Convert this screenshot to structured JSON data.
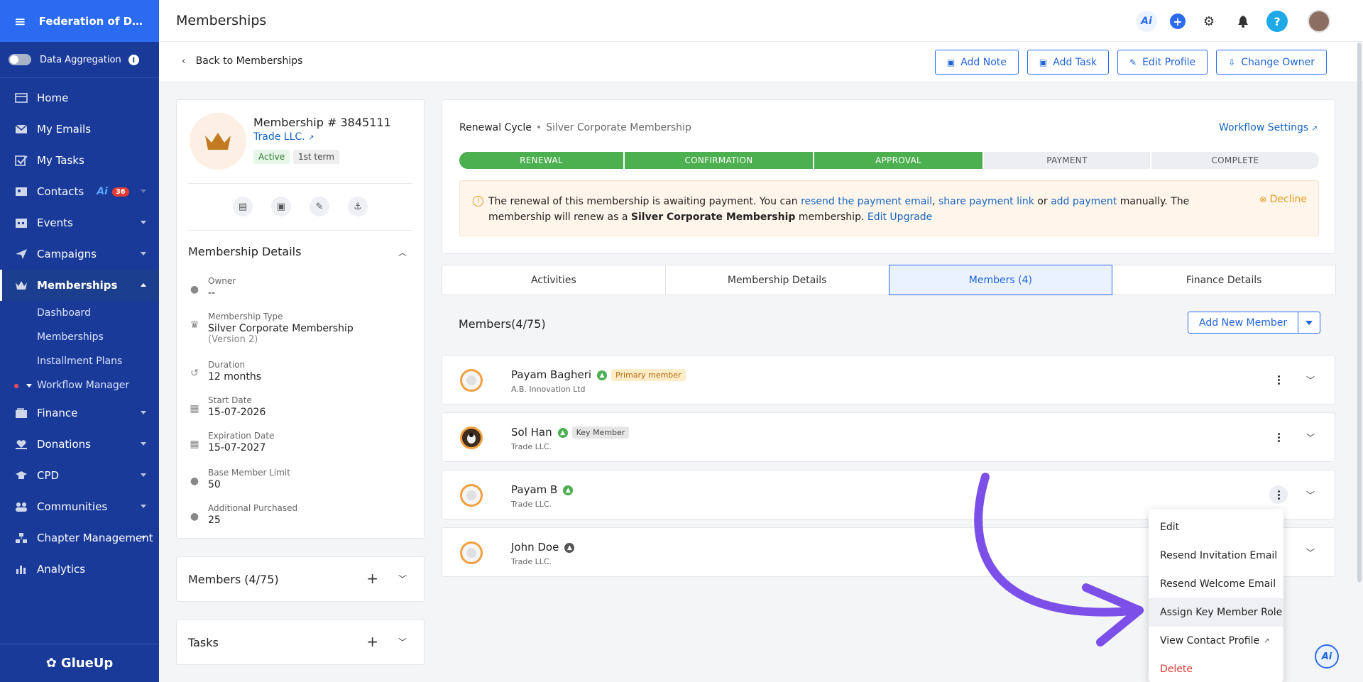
{
  "sidebar": {
    "org_name": "Federation of Digital...",
    "data_aggregation_label": "Data Aggregation",
    "items": [
      {
        "label": "Home",
        "icon": "home-icon"
      },
      {
        "label": "My Emails",
        "icon": "mail-icon"
      },
      {
        "label": "My Tasks",
        "icon": "checkbox-icon"
      },
      {
        "label": "Contacts",
        "icon": "contacts-icon",
        "badge": "36"
      },
      {
        "label": "Events",
        "icon": "calendar-icon"
      },
      {
        "label": "Campaigns",
        "icon": "send-icon"
      },
      {
        "label": "Memberships",
        "icon": "crown-icon"
      },
      {
        "label": "Finance",
        "icon": "wallet-icon"
      },
      {
        "label": "Donations",
        "icon": "heart-hand-icon"
      },
      {
        "label": "CPD",
        "icon": "graduation-cap-icon"
      },
      {
        "label": "Communities",
        "icon": "people-icon"
      },
      {
        "label": "Chapter Management",
        "icon": "org-chart-icon"
      },
      {
        "label": "Analytics",
        "icon": "bar-chart-icon"
      }
    ],
    "memberships_sub": [
      "Dashboard",
      "Memberships",
      "Installment Plans",
      "Workflow Manager"
    ],
    "brand": "GlueUp"
  },
  "header": {
    "title": "Memberships",
    "back_label": "Back to Memberships",
    "actions": [
      "Add Note",
      "Add Task",
      "Edit Profile",
      "Change Owner"
    ]
  },
  "membership": {
    "title": "Membership # 3845111",
    "org": "Trade LLC.",
    "status": "Active",
    "term": "1st term",
    "section_title": "Membership Details",
    "details": [
      {
        "label": "Owner",
        "value": "--",
        "icon": "person-icon"
      },
      {
        "label": "Membership Type",
        "value": "Silver Corporate Membership",
        "sub": "(Version 2)",
        "icon": "crown-icon"
      },
      {
        "label": "Duration",
        "value": "12 months",
        "icon": "history-icon"
      },
      {
        "label": "Start Date",
        "value": "15-07-2026",
        "icon": "calendar-icon"
      },
      {
        "label": "Expiration Date",
        "value": "15-07-2027",
        "icon": "calendar-icon"
      },
      {
        "label": "Base Member Limit",
        "value": "50",
        "icon": "person-icon"
      },
      {
        "label": "Additional Purchased",
        "value": "25",
        "icon": "person-icon"
      }
    ],
    "members_collapsed": "Members (4/75)",
    "tasks_collapsed": "Tasks"
  },
  "renewal": {
    "title": "Renewal Cycle",
    "separator": "•",
    "plan": "Silver Corporate Membership",
    "workflow_link": "Workflow Settings",
    "steps": [
      {
        "label": "RENEWAL",
        "done": true
      },
      {
        "label": "CONFIRMATION",
        "done": true
      },
      {
        "label": "APPROVAL",
        "done": true
      },
      {
        "label": "PAYMENT",
        "done": false
      },
      {
        "label": "COMPLETE",
        "done": false
      }
    ],
    "notice": {
      "t1": "The renewal of this membership is awaiting payment. You can ",
      "l1": "resend the payment email",
      "t2": ", ",
      "l2": "share payment link",
      "t3": " or ",
      "l3": "add payment",
      "t4": " manually. The membership will renew as a ",
      "b1": "Silver Corporate Membership",
      "t5": " membership. ",
      "l4": "Edit Upgrade",
      "decline": "Decline"
    }
  },
  "tabs": [
    "Activities",
    "Membership Details",
    "Members (4)",
    "Finance Details"
  ],
  "members": {
    "heading": "Members(4/75)",
    "add_button": "Add New Member",
    "rows": [
      {
        "name": "Payam Bagheri",
        "org": "A.B. Innovation Ltd",
        "tag": "Primary member"
      },
      {
        "name": "Sol Han",
        "org": "Trade LLC.",
        "tag": "Key Member"
      },
      {
        "name": "Payam B",
        "org": "Trade LLC.",
        "tag": ""
      },
      {
        "name": "John Doe",
        "org": "Trade LLC.",
        "tag": ""
      }
    ]
  },
  "menu": {
    "items": [
      "Edit",
      "Resend Invitation Email",
      "Resend Welcome Email",
      "Assign Key Member Role",
      "View Contact Profile",
      "Delete"
    ]
  },
  "colors": {
    "sidebar": "#1a3a9a",
    "accent": "#2a6bf2",
    "success": "#4caf50",
    "warning": "#e69a1c",
    "danger": "#e53935",
    "arrow": "#7b4fe8"
  }
}
